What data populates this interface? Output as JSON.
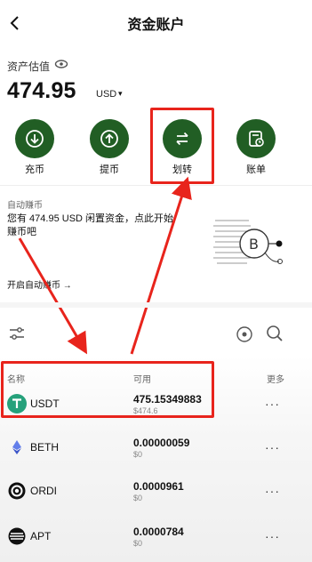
{
  "header": {
    "title": "资金账户"
  },
  "estimate": {
    "label": "资产估值",
    "value": "474.95",
    "unit": "USD",
    "unit_caret": "▾"
  },
  "actions": [
    {
      "label": "充币",
      "icon": "deposit-icon"
    },
    {
      "label": "提币",
      "icon": "withdraw-icon"
    },
    {
      "label": "划转",
      "icon": "transfer-icon"
    },
    {
      "label": "账单",
      "icon": "bill-icon"
    }
  ],
  "auto_earn": {
    "title": "自动赚币",
    "line1": "您有 474.95 USD 闲置资金，点此开始",
    "line2": "赚币吧",
    "link": "开启自动赚币 →"
  },
  "table": {
    "headers": {
      "name": "名称",
      "available": "可用",
      "more": "更多"
    },
    "rows": [
      {
        "name": "USDT",
        "amount": "475.15349883",
        "usd": "$474.6",
        "more": "···"
      },
      {
        "name": "BETH",
        "amount": "0.00000059",
        "usd": "$0",
        "more": "···"
      },
      {
        "name": "ORDI",
        "amount": "0.0000961",
        "usd": "$0",
        "more": "···"
      },
      {
        "name": "APT",
        "amount": "0.0000784",
        "usd": "$0",
        "more": "···"
      }
    ]
  },
  "colors": {
    "accent_green": "#215e24",
    "annotation_red": "#e8241c"
  }
}
